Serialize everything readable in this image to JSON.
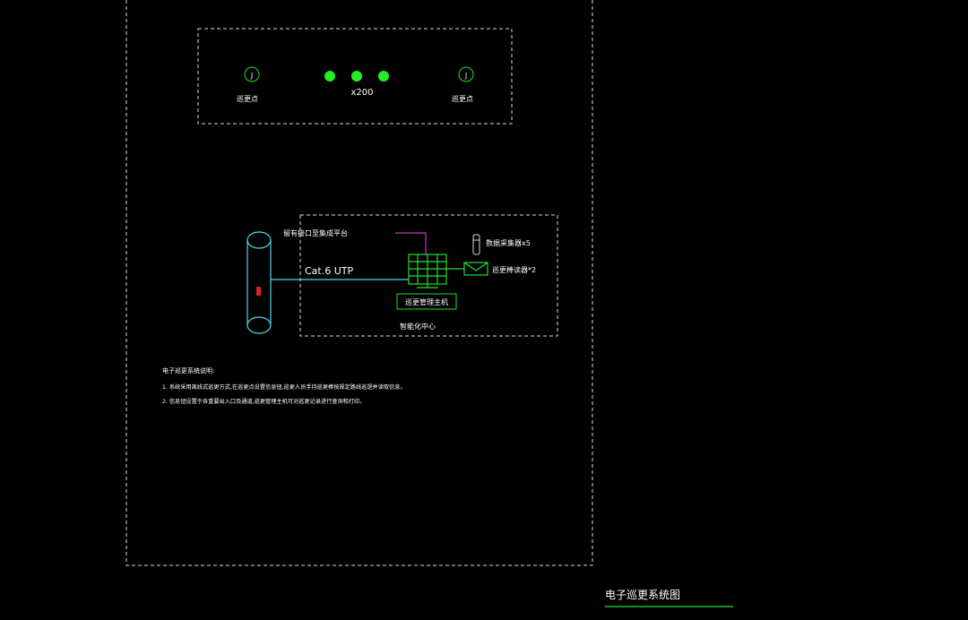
{
  "colors": {
    "background": "#000000",
    "frame": "#d9d9d9",
    "line_cyan": "#55d6ee",
    "line_green": "#20e030",
    "line_magenta": "#cc33cc",
    "patrol_dot": "#22ee22",
    "text": "#ffffff",
    "title_underline": "#20c020",
    "cabinet_mark": "#dd2222"
  },
  "patrol_area": {
    "point_left_label": "巡更点",
    "point_right_label": "巡更点",
    "point_symbol": "J",
    "count_label": "x200"
  },
  "control_center": {
    "interface_label": "留有接口至集成平台",
    "cable_label": "Cat.6  UTP",
    "host_label": "巡更管理主机",
    "center_label": "智能化中心",
    "collector_label": "数据采集器x5",
    "reader_label": "巡更棒读器*2"
  },
  "notes": {
    "heading": "电子巡更系统说明:",
    "line1": "1. 系统采用离线式巡更方式,在巡更点设置信息钮,巡更人员手持巡更棒按规定路线巡逻并读取信息。",
    "line2": "2. 信息钮设置于各重要出入口及通道,巡更管理主机可对巡更记录进行查询和打印。"
  },
  "title_block": {
    "title": "电子巡更系统图"
  }
}
